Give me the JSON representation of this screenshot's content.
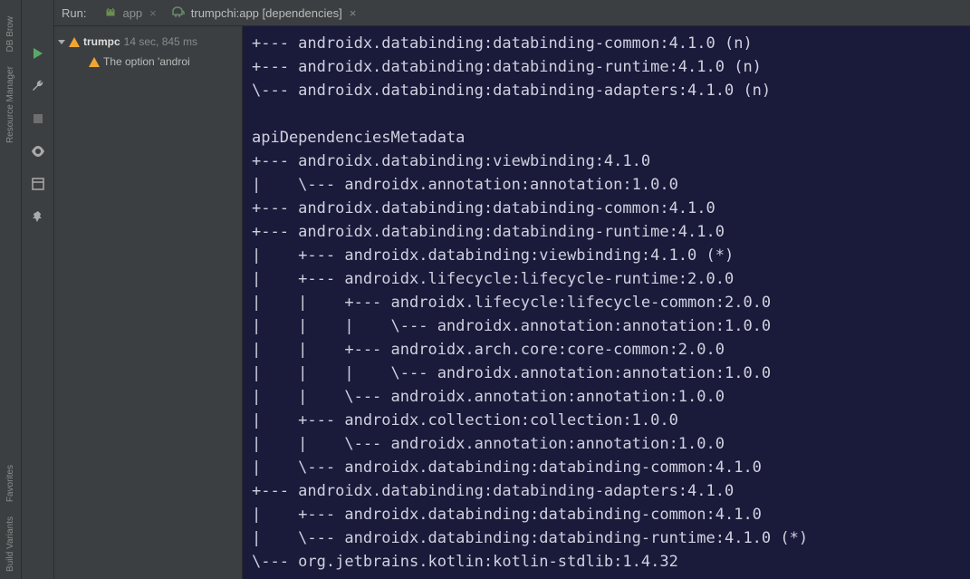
{
  "tabbar": {
    "run_label": "Run:",
    "tab1": {
      "label": "app",
      "close": "×"
    },
    "tab2": {
      "label": "trumpchi:app [dependencies]",
      "close": "×"
    }
  },
  "sidebar": {
    "labels": [
      "DB Brow",
      "Resource Manager",
      "Favorites",
      "Build Variants"
    ]
  },
  "tree": {
    "root": {
      "name": "trumpc",
      "time": "14 sec, 845 ms"
    },
    "warn1": "The option 'androi"
  },
  "console": {
    "lines": [
      "+--- androidx.databinding:databinding-common:4.1.0 (n)",
      "+--- androidx.databinding:databinding-runtime:4.1.0 (n)",
      "\\--- androidx.databinding:databinding-adapters:4.1.0 (n)",
      "",
      "apiDependenciesMetadata",
      "+--- androidx.databinding:viewbinding:4.1.0",
      "|    \\--- androidx.annotation:annotation:1.0.0",
      "+--- androidx.databinding:databinding-common:4.1.0",
      "+--- androidx.databinding:databinding-runtime:4.1.0",
      "|    +--- androidx.databinding:viewbinding:4.1.0 (*)",
      "|    +--- androidx.lifecycle:lifecycle-runtime:2.0.0",
      "|    |    +--- androidx.lifecycle:lifecycle-common:2.0.0",
      "|    |    |    \\--- androidx.annotation:annotation:1.0.0",
      "|    |    +--- androidx.arch.core:core-common:2.0.0",
      "|    |    |    \\--- androidx.annotation:annotation:1.0.0",
      "|    |    \\--- androidx.annotation:annotation:1.0.0",
      "|    +--- androidx.collection:collection:1.0.0",
      "|    |    \\--- androidx.annotation:annotation:1.0.0",
      "|    \\--- androidx.databinding:databinding-common:4.1.0",
      "+--- androidx.databinding:databinding-adapters:4.1.0",
      "|    +--- androidx.databinding:databinding-common:4.1.0",
      "|    \\--- androidx.databinding:databinding-runtime:4.1.0 (*)",
      "\\--- org.jetbrains.kotlin:kotlin-stdlib:1.4.32"
    ]
  }
}
